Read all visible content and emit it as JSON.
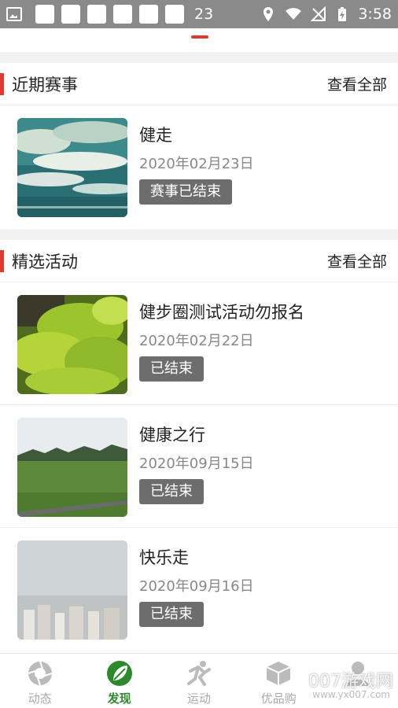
{
  "status_bar": {
    "notification_count": "23",
    "time": "3:58"
  },
  "recent_events": {
    "title": "近期赛事",
    "view_all": "查看全部",
    "items": [
      {
        "title": "健走",
        "date": "2020年02月23日",
        "status": "赛事已结束"
      }
    ]
  },
  "featured_activities": {
    "title": "精选活动",
    "view_all": "查看全部",
    "items": [
      {
        "title": "健步圈测试活动勿报名",
        "date": "2020年02月22日",
        "status": "已结束"
      },
      {
        "title": "健康之行",
        "date": "2020年09月15日",
        "status": "已结束"
      },
      {
        "title": "快乐走",
        "date": "2020年09月16日",
        "status": "已结束"
      }
    ]
  },
  "bottom_nav": {
    "tabs": [
      {
        "label": "动态",
        "icon": "aperture-icon",
        "active": false
      },
      {
        "label": "发现",
        "icon": "leaf-icon",
        "active": true
      },
      {
        "label": "运动",
        "icon": "runner-icon",
        "active": false
      },
      {
        "label": "优品购",
        "icon": "box-icon",
        "active": false
      },
      {
        "label": "",
        "icon": "user-icon",
        "active": false
      }
    ]
  },
  "watermark": {
    "brand": "007游戏网",
    "url": "www.yx007.com"
  },
  "colors": {
    "accent": "#e03a2e",
    "active_tab": "#2c8a2c",
    "badge": "#6d6d6d"
  }
}
